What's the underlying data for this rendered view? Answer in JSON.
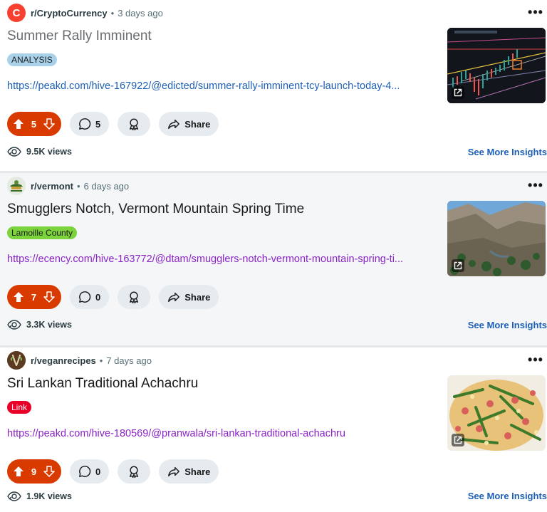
{
  "posts": [
    {
      "subreddit": "r/CryptoCurrency",
      "separator": "•",
      "time": "3 days ago",
      "title": "Summer Rally Imminent",
      "flair": "ANALYSIS",
      "url": "https://peakd.com/hive-167922/@edicted/summer-rally-imminent-tcy-launch-today-4...",
      "upvotes": "5",
      "comments": "5",
      "share_label": "Share",
      "views": "9.5K views",
      "insights_label": "See More Insights",
      "flair_color": "#a9d2ea"
    },
    {
      "subreddit": "r/vermont",
      "separator": "•",
      "time": "6 days ago",
      "title": "Smugglers Notch, Vermont Mountain Spring Time",
      "flair": "Lamoille County",
      "url": "https://ecency.com/hive-163772/@dtam/smugglers-notch-vermont-mountain-spring-ti...",
      "upvotes": "7",
      "comments": "0",
      "share_label": "Share",
      "views": "3.3K views",
      "insights_label": "See More Insights",
      "flair_color": "#7dd33c"
    },
    {
      "subreddit": "r/veganrecipes",
      "separator": "•",
      "time": "7 days ago",
      "title": "Sri Lankan Traditional Achachru",
      "flair": "Link",
      "url": "https://peakd.com/hive-180569/@pranwala/sri-lankan-traditional-achachru",
      "upvotes": "9",
      "comments": "0",
      "share_label": "Share",
      "views": "1.9K views",
      "insights_label": "See More Insights",
      "flair_color": "#ea0027"
    }
  ],
  "colors": {
    "upvote_accent": "#d93a00",
    "link_blue": "#1d5fb5",
    "link_visited": "#8a24c6",
    "pill_bg": "#e5ebee"
  },
  "icons": {
    "avatar_crypto_glyph": "C",
    "more": "•••"
  }
}
